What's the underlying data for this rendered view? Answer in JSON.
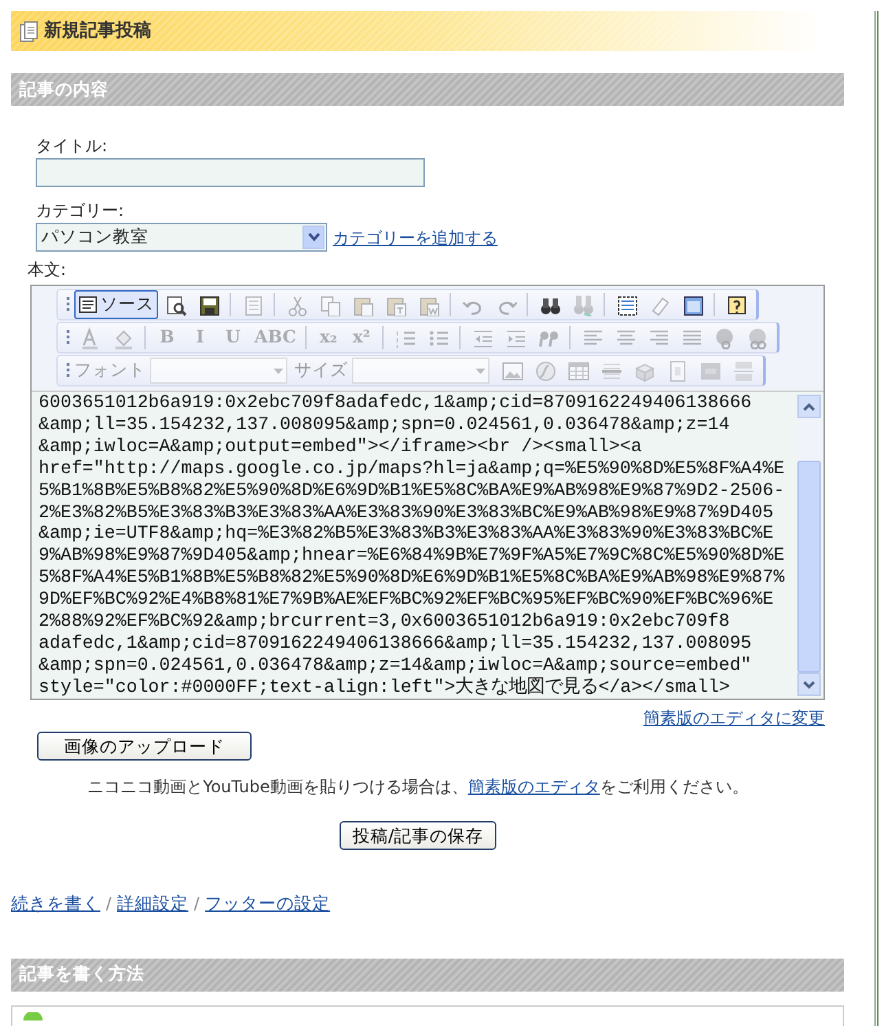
{
  "page_title": "新規記事投稿",
  "sections": [
    {
      "title": "記事の内容"
    },
    {
      "title": "記事を書く方法"
    }
  ],
  "title_field": {
    "label": "タイトル:"
  },
  "category": {
    "label": "カテゴリー:",
    "value": "パソコン教室",
    "add_link": "カテゴリーを追加する"
  },
  "body_label": "本文:",
  "toolbar": [
    [
      {
        "kind": "button",
        "label": "ソース",
        "selected": true,
        "disabled": false
      },
      {
        "kind": "button",
        "selected": false,
        "disabled": false
      },
      {
        "kind": "button",
        "selected": false,
        "disabled": false
      },
      {
        "kind": "sep"
      },
      {
        "kind": "button",
        "selected": false,
        "disabled": true
      },
      {
        "kind": "sep"
      },
      {
        "kind": "button",
        "selected": false,
        "disabled": true
      },
      {
        "kind": "button",
        "selected": false,
        "disabled": true
      },
      {
        "kind": "button",
        "selected": false,
        "disabled": true
      },
      {
        "kind": "button",
        "selected": false,
        "disabled": true
      },
      {
        "kind": "button",
        "selected": false,
        "disabled": true
      },
      {
        "kind": "sep"
      },
      {
        "kind": "button",
        "selected": false,
        "disabled": true
      },
      {
        "kind": "button",
        "selected": false,
        "disabled": true
      },
      {
        "kind": "sep"
      },
      {
        "kind": "button",
        "selected": false,
        "disabled": false
      },
      {
        "kind": "button",
        "selected": false,
        "disabled": true
      },
      {
        "kind": "sep"
      },
      {
        "kind": "button",
        "selected": false,
        "disabled": false
      },
      {
        "kind": "button",
        "selected": false,
        "disabled": true
      },
      {
        "kind": "button",
        "selected": false,
        "disabled": false
      },
      {
        "kind": "sep"
      },
      {
        "kind": "button",
        "selected": false,
        "disabled": false
      }
    ],
    [
      {
        "kind": "button",
        "selected": false,
        "disabled": true
      },
      {
        "kind": "button",
        "selected": false,
        "disabled": true
      },
      {
        "kind": "sep"
      },
      {
        "kind": "text",
        "label": "B",
        "selected": false,
        "disabled": true
      },
      {
        "kind": "text",
        "label": "I",
        "selected": false,
        "disabled": true
      },
      {
        "kind": "text",
        "label": "U",
        "selected": false,
        "disabled": true
      },
      {
        "kind": "text",
        "label": "ABC",
        "selected": false,
        "disabled": true
      },
      {
        "kind": "sep"
      },
      {
        "kind": "text",
        "label": "x₂",
        "selected": false,
        "disabled": true
      },
      {
        "kind": "text",
        "label": "x²",
        "selected": false,
        "disabled": true
      },
      {
        "kind": "sep"
      },
      {
        "kind": "button",
        "selected": false,
        "disabled": true
      },
      {
        "kind": "button",
        "selected": false,
        "disabled": true
      },
      {
        "kind": "sep"
      },
      {
        "kind": "button",
        "selected": false,
        "disabled": true
      },
      {
        "kind": "button",
        "selected": false,
        "disabled": true
      },
      {
        "kind": "button",
        "selected": false,
        "disabled": true
      },
      {
        "kind": "sep"
      },
      {
        "kind": "button",
        "selected": false,
        "disabled": true
      },
      {
        "kind": "button",
        "selected": false,
        "disabled": true
      },
      {
        "kind": "button",
        "selected": false,
        "disabled": true
      },
      {
        "kind": "button",
        "selected": false,
        "disabled": true
      },
      {
        "kind": "button",
        "selected": false,
        "disabled": true
      },
      {
        "kind": "button",
        "selected": false,
        "disabled": true
      }
    ],
    [
      {
        "kind": "combo",
        "label": "フォント",
        "disabled": true
      },
      {
        "kind": "combo",
        "label": "サイズ",
        "disabled": true
      },
      {
        "kind": "button",
        "selected": false,
        "disabled": true
      },
      {
        "kind": "button",
        "selected": false,
        "disabled": true
      },
      {
        "kind": "button",
        "selected": false,
        "disabled": true
      },
      {
        "kind": "button",
        "selected": false,
        "disabled": true
      },
      {
        "kind": "button",
        "selected": false,
        "disabled": true
      },
      {
        "kind": "button",
        "selected": false,
        "disabled": true
      },
      {
        "kind": "button",
        "selected": false,
        "disabled": true
      },
      {
        "kind": "button",
        "selected": false,
        "disabled": true
      }
    ]
  ],
  "source_lines": [
    "6003651012b6a919:0x2ebc709f8adafedc,1&amp;cid=8709162249406138666",
    "&amp;ll=35.154232,137.008095&amp;spn=0.024561,0.036478&amp;z=14",
    "&amp;iwloc=A&amp;output=embed\"></iframe><br /><small><a",
    "href=\"http://maps.google.co.jp/maps?hl=ja&amp;q=%E5%90%8D%E5%8F%A4%E",
    "5%B1%8B%E5%B8%82%E5%90%8D%E6%9D%B1%E5%8C%BA%E9%AB%98%E9%87%9D2-2506-",
    "2%E3%82%B5%E3%83%B3%E3%83%AA%E3%83%90%E3%83%BC%E9%AB%98%E9%87%9D405",
    "&amp;ie=UTF8&amp;hq=%E3%82%B5%E3%83%B3%E3%83%AA%E3%83%90%E3%83%BC%E",
    "9%AB%98%E9%87%9D405&amp;hnear=%E6%84%9B%E7%9F%A5%E7%9C%8C%E5%90%8D%E",
    "5%8F%A4%E5%B1%8B%E5%B8%82%E5%90%8D%E6%9D%B1%E5%8C%BA%E9%AB%98%E9%87%",
    "9D%EF%BC%92%E4%B8%81%E7%9B%AE%EF%BC%92%EF%BC%95%EF%BC%90%EF%BC%96%E",
    "2%88%92%EF%BC%92&amp;brcurrent=3,0x6003651012b6a919:0x2ebc709f8",
    "adafedc,1&amp;cid=8709162249406138666&amp;ll=35.154232,137.008095",
    "&amp;spn=0.024561,0.036478&amp;z=14&amp;iwloc=A&amp;source=embed\"",
    "style=\"color:#0000FF;text-align:left\">大きな地図で見る</a></small>"
  ],
  "simple_editor_link": "簡素版のエディタに変更",
  "upload_button": "画像のアップロード",
  "note": {
    "before": "ニコニコ動画とYouTube動画を貼りつける場合は、",
    "link": "簡素版のエディタ",
    "after": "をご利用ください。"
  },
  "save_button": "投稿/記事の保存",
  "footer_links": [
    {
      "label": "続きを書く"
    },
    {
      "label": "詳細設定"
    },
    {
      "label": "フッターの設定"
    }
  ],
  "footer_separator": "/"
}
